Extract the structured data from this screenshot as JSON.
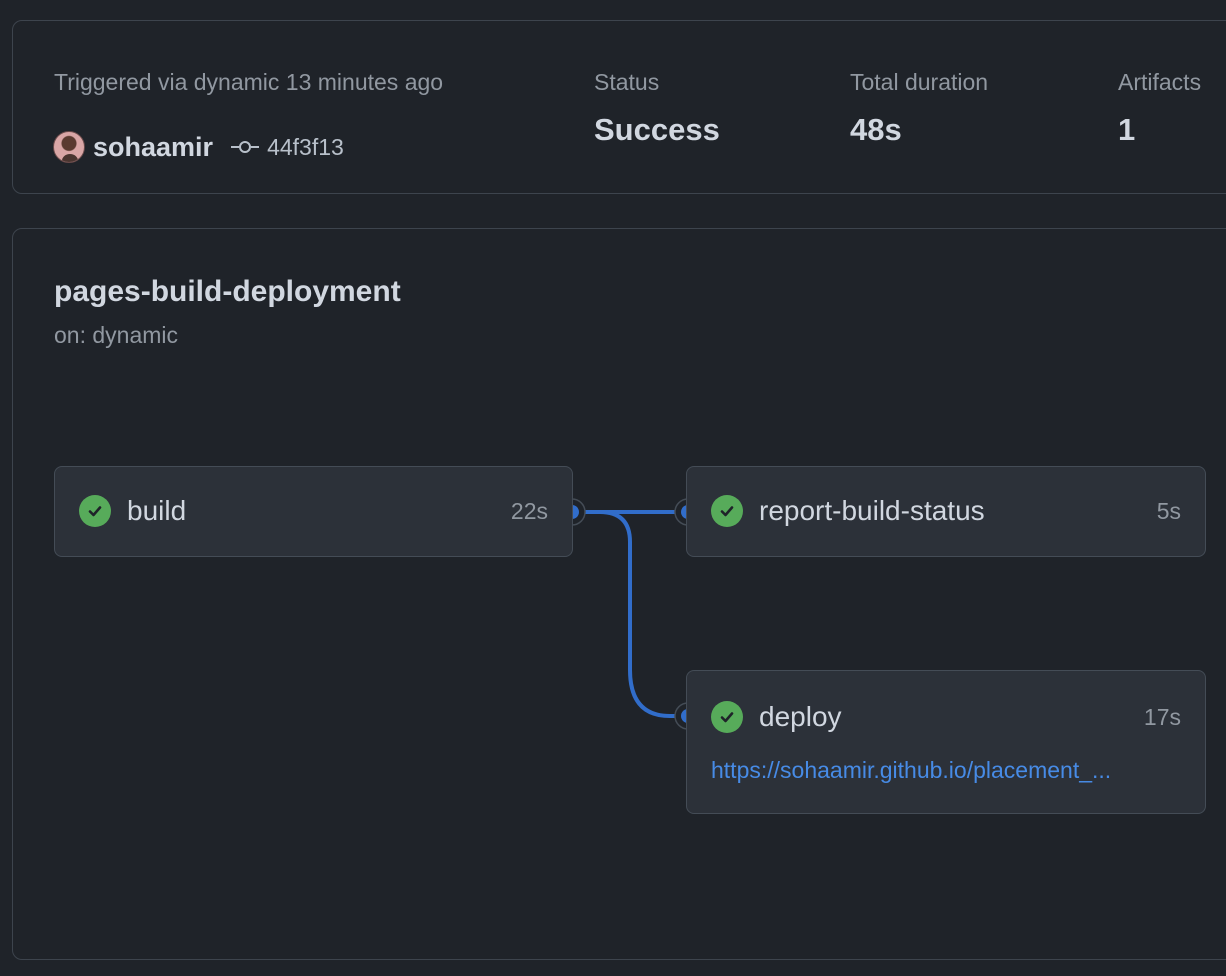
{
  "summary": {
    "trigger_label": "Triggered via dynamic 13 minutes ago",
    "actor": "sohaamir",
    "commit_sha": "44f3f13",
    "status_label": "Status",
    "status_value": "Success",
    "duration_label": "Total duration",
    "duration_value": "48s",
    "artifacts_label": "Artifacts",
    "artifacts_value": "1"
  },
  "workflow": {
    "name": "pages-build-deployment",
    "trigger": "on: dynamic",
    "jobs": [
      {
        "name": "build",
        "duration": "22s",
        "status": "success"
      },
      {
        "name": "report-build-status",
        "duration": "5s",
        "status": "success"
      },
      {
        "name": "deploy",
        "duration": "17s",
        "status": "success",
        "url": "https://sohaamir.github.io/placement_..."
      }
    ]
  },
  "colors": {
    "background": "#1f2329",
    "success": "#57ab5a",
    "connector": "#316dca",
    "link": "#478be6"
  },
  "icons": [
    "avatar",
    "commit-icon",
    "check-circle-icon"
  ]
}
